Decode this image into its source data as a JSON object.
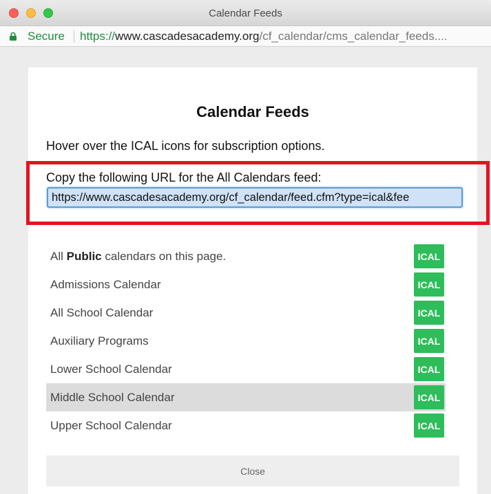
{
  "window": {
    "title": "Calendar Feeds"
  },
  "address_bar": {
    "secure_label": "Secure",
    "url_scheme": "https://",
    "url_host": "www.cascadesacademy.org",
    "url_path": "/cf_calendar/cms_calendar_feeds...."
  },
  "modal": {
    "title": "Calendar Feeds",
    "hover_text": "Hover over the ICAL icons for subscription options.",
    "copy_label": "Copy the following URL for the All Calendars feed:",
    "feed_url": "https://www.cascadesacademy.org/cf_calendar/feed.cfm?type=ical&fee",
    "public_row": {
      "prefix": "All ",
      "bold": "Public",
      "suffix": " calendars on this page.",
      "ical": "ICAL"
    },
    "calendars": [
      {
        "name": "Admissions Calendar",
        "ical": "ICAL"
      },
      {
        "name": "All School Calendar",
        "ical": "ICAL"
      },
      {
        "name": "Auxiliary Programs",
        "ical": "ICAL"
      },
      {
        "name": "Lower School Calendar",
        "ical": "ICAL"
      },
      {
        "name": "Middle School Calendar",
        "ical": "ICAL"
      },
      {
        "name": "Upper School Calendar",
        "ical": "ICAL"
      }
    ],
    "close_label": "Close"
  },
  "colors": {
    "ical_green": "#2ebd5a",
    "highlight_red": "#e3131e",
    "secure_green": "#1e8e3e"
  }
}
